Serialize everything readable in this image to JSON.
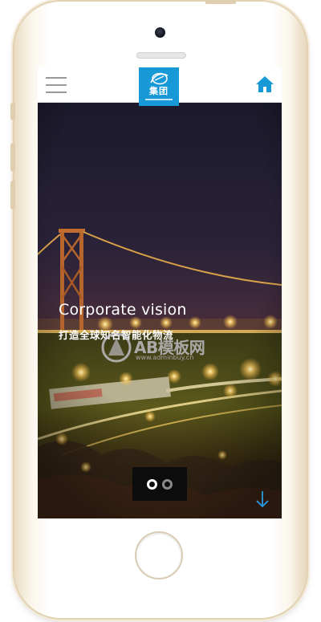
{
  "header": {
    "logo_text": "集团",
    "menu_icon": "hamburger-menu-icon",
    "home_icon": "home-icon",
    "accent_color": "#1799d8"
  },
  "hero": {
    "title": "Corporate vision",
    "subtitle": "打造全球知名智能化物流",
    "slides_total": 2,
    "active_slide": 1,
    "scroll_icon": "arrow-down-icon"
  },
  "watermark": {
    "text": "AB模板网",
    "url": "www.adminbuy.cn"
  }
}
